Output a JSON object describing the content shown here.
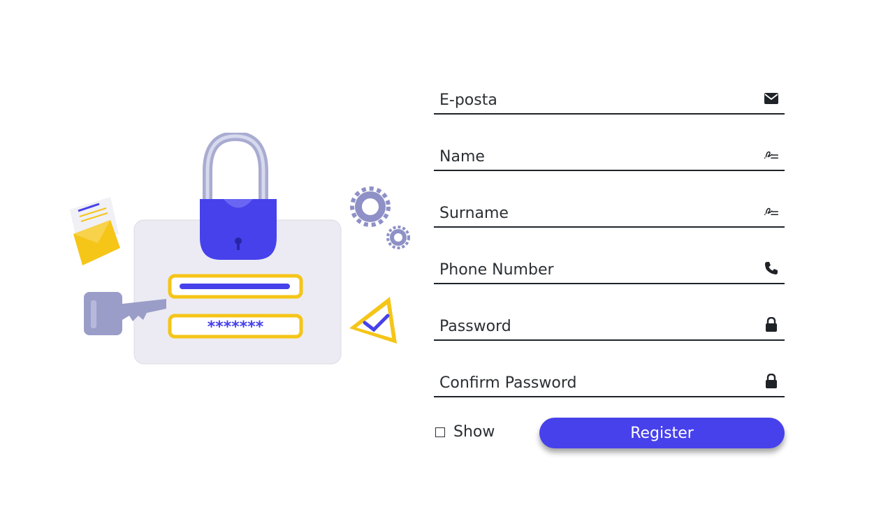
{
  "form": {
    "fields": [
      {
        "placeholder": "E-posta",
        "icon": "envelope-icon"
      },
      {
        "placeholder": "Name",
        "icon": "signature-icon"
      },
      {
        "placeholder": "Surname",
        "icon": "signature-icon"
      },
      {
        "placeholder": "Phone Number",
        "icon": "phone-icon"
      },
      {
        "placeholder": "Password",
        "icon": "lock-icon"
      },
      {
        "placeholder": "Confirm Password",
        "icon": "lock-icon"
      }
    ],
    "show_label": "Show",
    "register_label": "Register"
  },
  "illustration": {
    "password_mask": "*******"
  },
  "colors": {
    "accent": "#4741eb",
    "text": "#1f2328",
    "yellow": "#f5c518"
  }
}
